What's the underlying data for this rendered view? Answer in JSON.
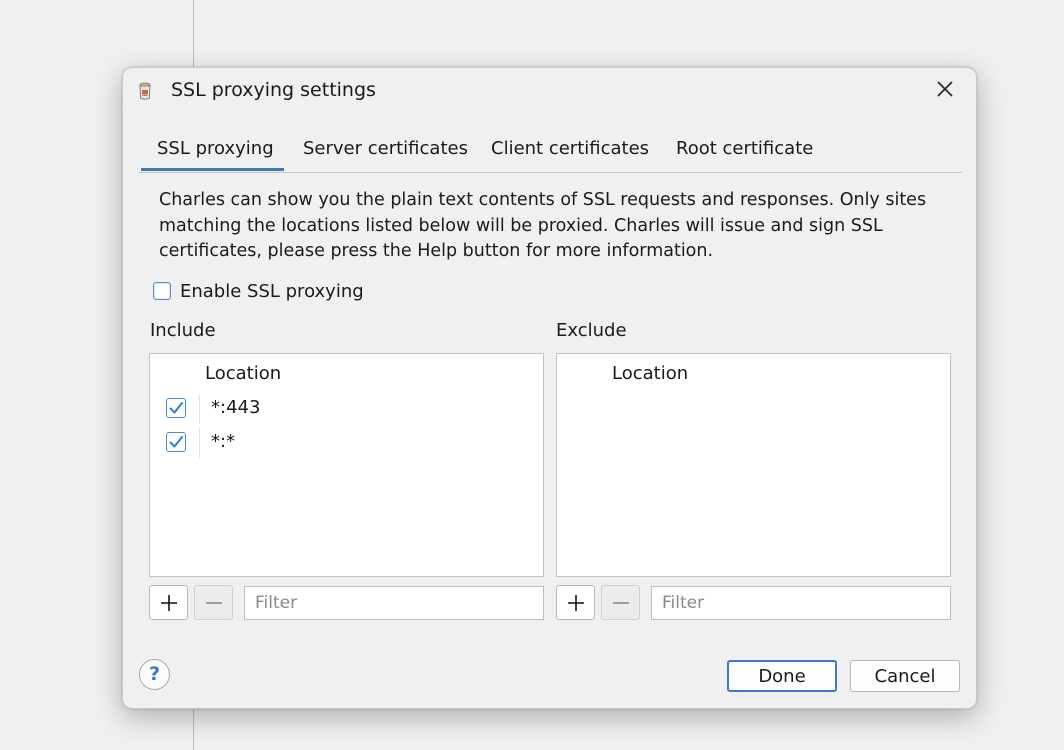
{
  "dialog": {
    "title": "SSL proxying settings",
    "app_icon": "charles-pot-icon",
    "close_icon": "close-icon"
  },
  "tabs": [
    {
      "label": "SSL proxying",
      "active": true
    },
    {
      "label": "Server certificates",
      "active": false
    },
    {
      "label": "Client certificates",
      "active": false
    },
    {
      "label": "Root certificate",
      "active": false
    }
  ],
  "description": "Charles can show you the plain text contents of SSL requests and responses. Only sites matching the locations listed below will be proxied. Charles will issue and sign SSL certificates, please press the Help button for more information.",
  "enable_ssl": {
    "label": "Enable SSL proxying",
    "checked": false
  },
  "include": {
    "label": "Include",
    "column_header": "Location",
    "rows": [
      {
        "location": "*:443",
        "enabled": true
      },
      {
        "location": "*:*",
        "enabled": true
      }
    ],
    "filter_placeholder": "Filter"
  },
  "exclude": {
    "label": "Exclude",
    "column_header": "Location",
    "rows": [],
    "filter_placeholder": "Filter"
  },
  "buttons": {
    "help": "?",
    "done": "Done",
    "cancel": "Cancel"
  },
  "colors": {
    "accent": "#3d79c6",
    "dialog_bg": "#f0f0f0"
  }
}
